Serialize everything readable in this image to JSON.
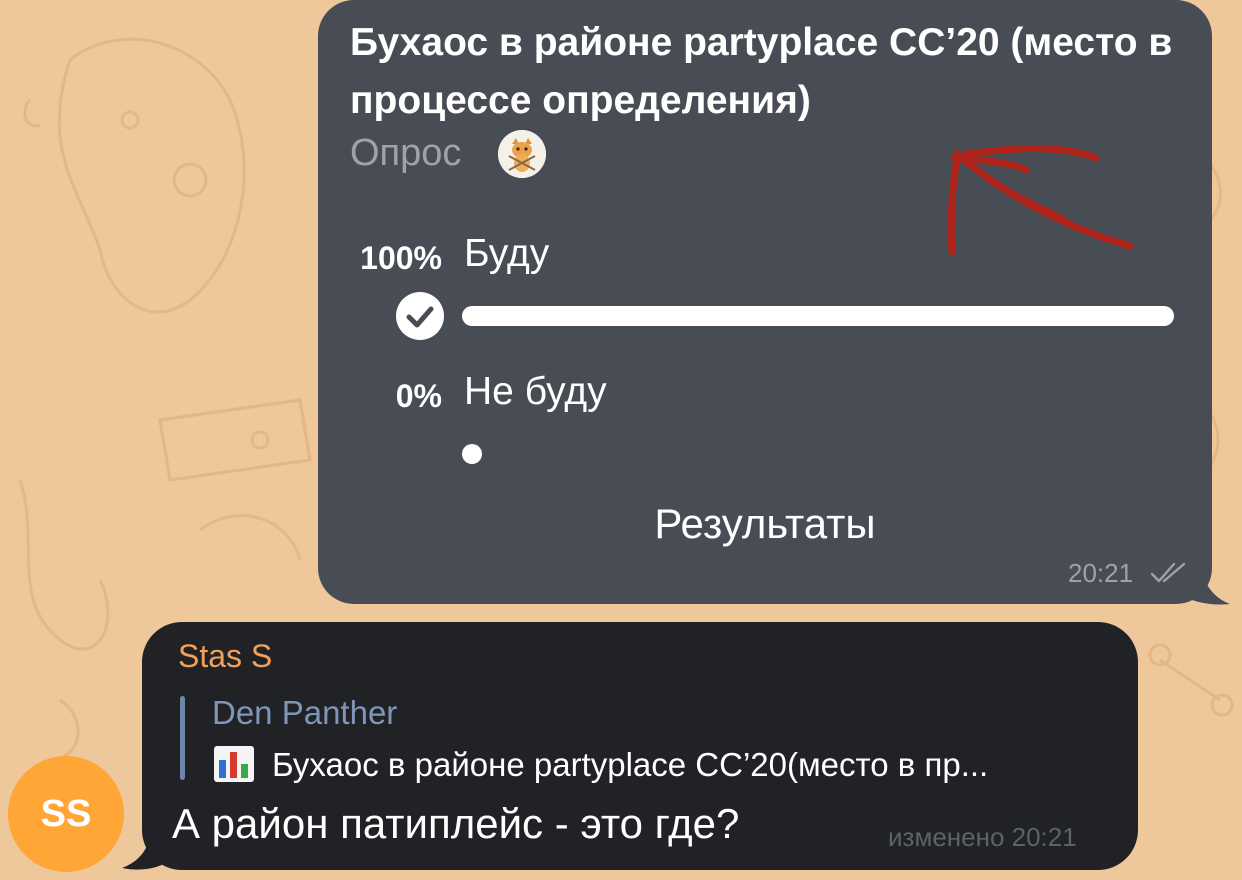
{
  "poll": {
    "question": "Бухаос в районе partyplace CC’20 (место в процессе определения)",
    "type_label": "Опрос",
    "voter_avatar_icon": "kitten-sticker-icon",
    "options": [
      {
        "percent": "100%",
        "label": "Буду",
        "fraction": 1.0,
        "selected": true
      },
      {
        "percent": "0%",
        "label": "Не буду",
        "fraction": 0.0,
        "selected": false
      }
    ],
    "results_label": "Результаты",
    "time": "20:21",
    "status_icon": "double-check-icon"
  },
  "reply": {
    "sender": "Stas S",
    "sender_color": "#f3a05b",
    "quote": {
      "author": "Den Panther",
      "icon": "bar-chart-icon",
      "text": "Бухаос в районе partyplace CC’20(место в пр..."
    },
    "text": "А район патиплейс - это где?",
    "edited_label": "изменено 20:21",
    "avatar_initials": "SS",
    "avatar_color": "#ffa636"
  },
  "colors": {
    "wallpaper": "#eec79a",
    "outgoing_bubble": "#484c54",
    "incoming_bubble": "#202226",
    "annotation": "#b0231a"
  }
}
